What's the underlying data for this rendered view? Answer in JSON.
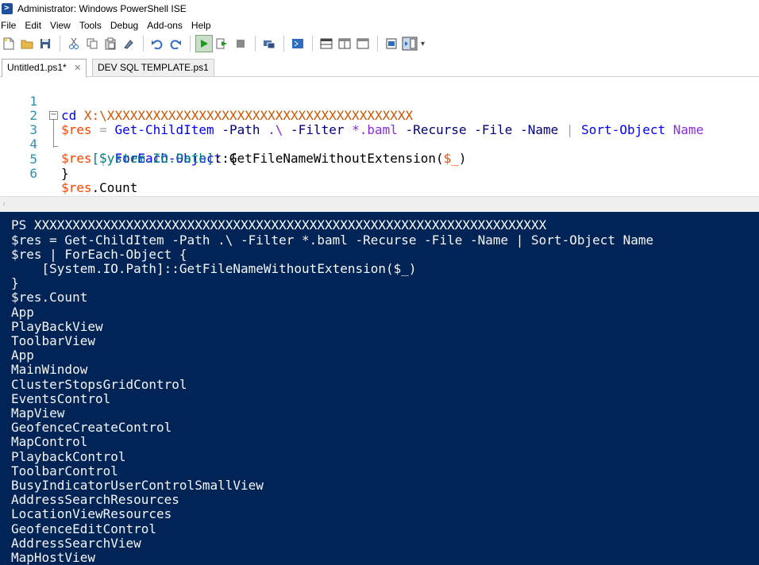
{
  "window": {
    "title": "Administrator: Windows PowerShell ISE"
  },
  "menu": [
    "File",
    "Edit",
    "View",
    "Tools",
    "Debug",
    "Add-ons",
    "Help"
  ],
  "toolbar": {
    "icons": [
      "new-file-icon",
      "open-folder-icon",
      "save-icon",
      "cut-icon",
      "copy-icon",
      "paste-icon",
      "clear-icon",
      "undo-icon",
      "redo-icon",
      "run-script-icon",
      "run-selection-icon",
      "stop-icon",
      "new-remote-tab-icon",
      "start-powershell-icon",
      "show-script-top-icon",
      "show-script-right-icon",
      "show-script-max-icon",
      "show-command-window-icon",
      "show-command-addon-icon"
    ]
  },
  "tabs": [
    {
      "label": "Untitled1.ps1*",
      "active": true
    },
    {
      "label": "DEV SQL TEMPLATE.ps1",
      "active": false
    }
  ],
  "editor": {
    "line_numbers": [
      "1",
      "2",
      "3",
      "4",
      "5",
      "6"
    ],
    "line1": {
      "cmd": "cd",
      "path": "X:\\XXXXXXXXXXXXXXXXXXXXXXXXXXXXXXXXXXXXXXXX"
    },
    "line2": {
      "var": "$res",
      "eq": "=",
      "cmd": "Get-ChildItem",
      "p1": "-Path",
      "v1": ".\\",
      "p2": "-Filter",
      "v2": "*.baml",
      "p3": "-Recurse",
      "p4": "-File",
      "p5": "-Name",
      "pipe": "|",
      "cmd2": "Sort-Object",
      "arg": "Name"
    },
    "line3": {
      "var": "$res",
      "pipe": "|",
      "cmd": "ForEach-Object",
      "brace": "{"
    },
    "line4": {
      "type": "[System.IO.Path]",
      "method": "::GetFileNameWithoutExtension(",
      "var": "$_",
      "close": ")"
    },
    "line5": {
      "brace": "}"
    },
    "line6": {
      "var": "$res",
      "prop": ".Count"
    }
  },
  "console": {
    "prompt_prefix": "PS",
    "prompt_path": "XXXXXXXXXXXXXXXXXXXXXXXXXXXXXXXXXXXXXXXXXXXXXXXXXXXXXXXXXXXXXXXXXXX",
    "lines": [
      "$res = Get-ChildItem -Path .\\ -Filter *.baml -Recurse -File -Name | Sort-Object Name",
      "$res | ForEach-Object {",
      "    [System.IO.Path]::GetFileNameWithoutExtension($_)",
      "}",
      "$res.Count",
      "App",
      "PlayBackView",
      "ToolbarView",
      "App",
      "MainWindow",
      "ClusterStopsGridControl",
      "EventsControl",
      "MapView",
      "GeofenceCreateControl",
      "MapControl",
      "PlaybackControl",
      "ToolbarControl",
      "BusyIndicatorUserControlSmallView",
      "AddressSearchResources",
      "LocationViewResources",
      "GeofenceEditControl",
      "AddressSearchView",
      "MapHostView"
    ]
  },
  "colors": {
    "console_bg": "#012456",
    "cmd": "#0000ff",
    "var": "#ff4500",
    "type": "#008080"
  }
}
